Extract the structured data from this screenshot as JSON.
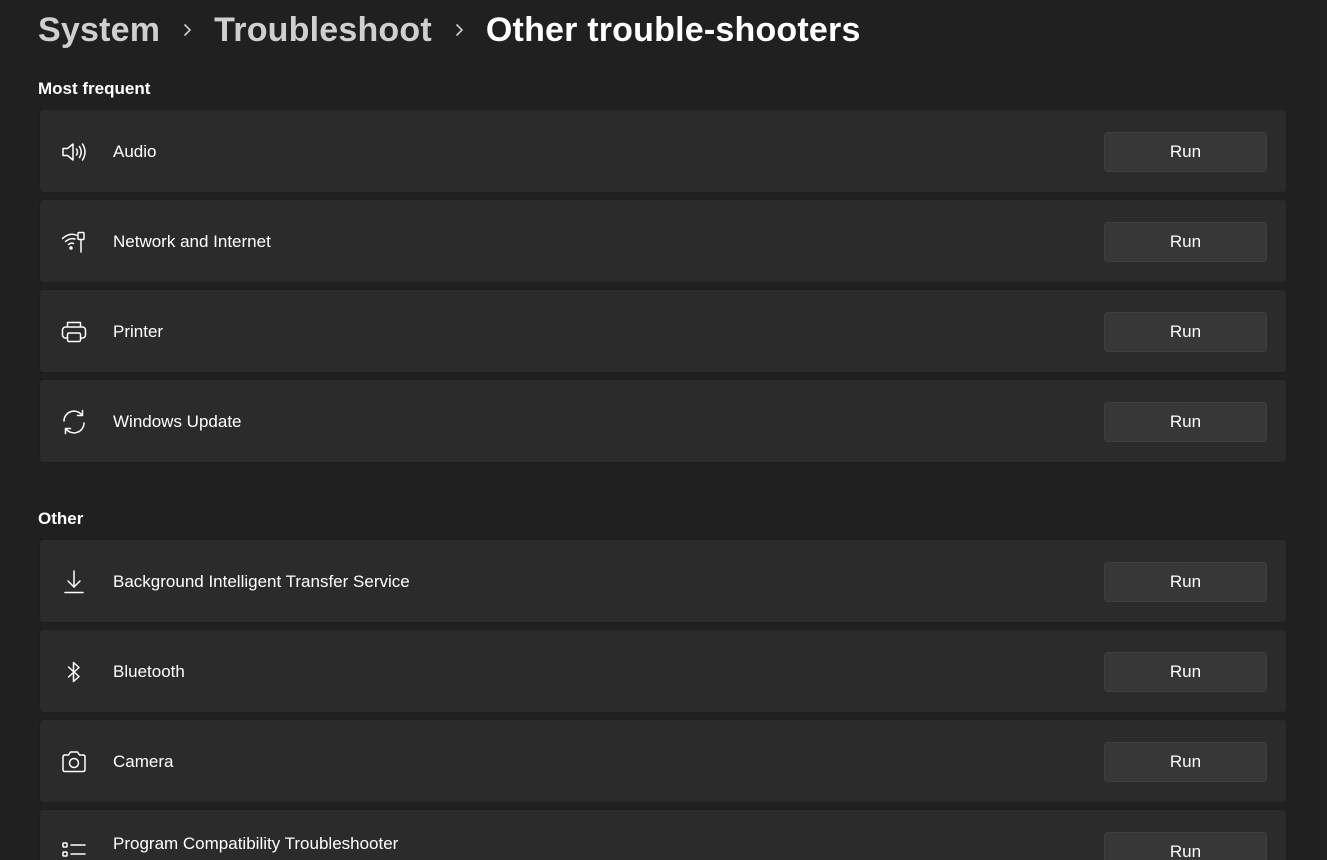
{
  "breadcrumb": {
    "items": [
      "System",
      "Troubleshoot",
      "Other trouble-shooters"
    ]
  },
  "sections": {
    "most_frequent": {
      "title": "Most frequent",
      "items": [
        {
          "label": "Audio",
          "icon": "speaker-icon",
          "button": "Run"
        },
        {
          "label": "Network and Internet",
          "icon": "network-icon",
          "button": "Run"
        },
        {
          "label": "Printer",
          "icon": "printer-icon",
          "button": "Run"
        },
        {
          "label": "Windows Update",
          "icon": "sync-icon",
          "button": "Run"
        }
      ]
    },
    "other": {
      "title": "Other",
      "items": [
        {
          "label": "Background Intelligent Transfer Service",
          "icon": "download-icon",
          "button": "Run"
        },
        {
          "label": "Bluetooth",
          "icon": "bluetooth-icon",
          "button": "Run"
        },
        {
          "label": "Camera",
          "icon": "camera-icon",
          "button": "Run"
        },
        {
          "label": "Program Compatibility Troubleshooter",
          "icon": "list-icon",
          "button": "Run"
        }
      ]
    }
  },
  "colors": {
    "background": "#202020",
    "card": "#2b2b2b",
    "button": "#373737",
    "text": "#ffffff"
  }
}
